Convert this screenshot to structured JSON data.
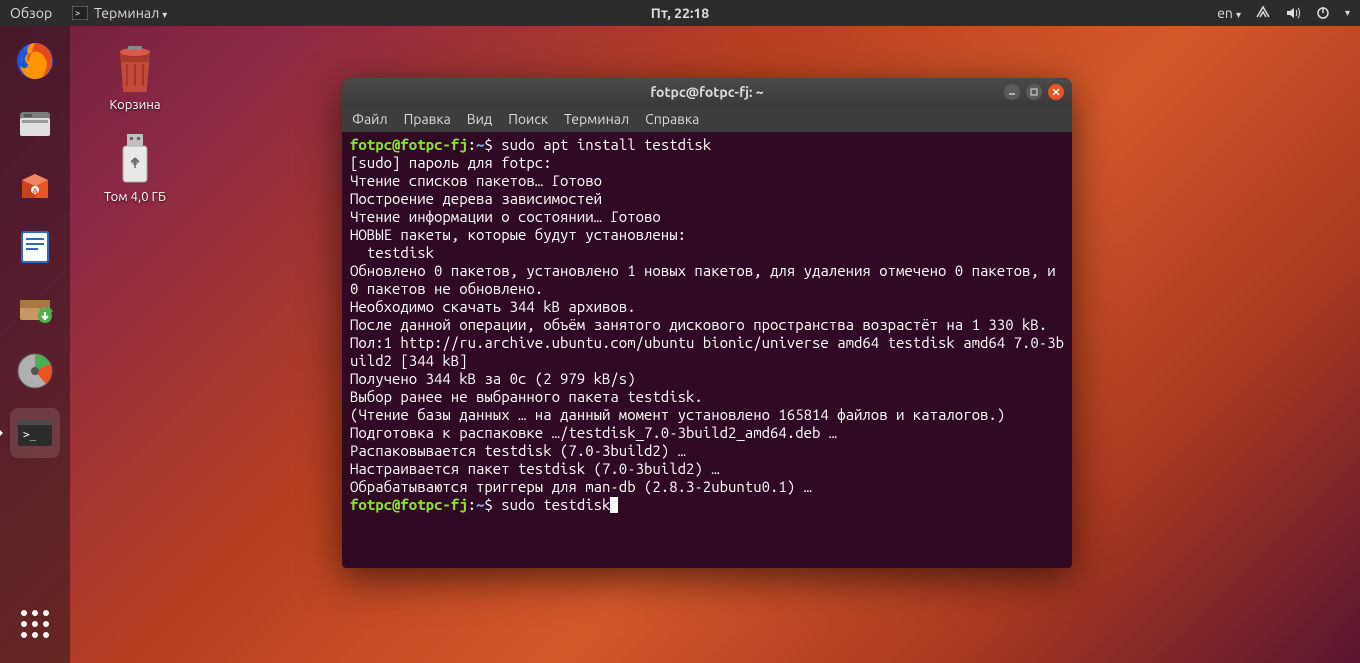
{
  "topbar": {
    "activities": "Обзор",
    "app_name": "Терминал",
    "clock": "Пт, 22:18",
    "lang": "en"
  },
  "desktop": {
    "trash": "Корзина",
    "usb": "Том 4,0 ГБ"
  },
  "window": {
    "title": "fotpc@fotpc-fj: ~",
    "menu": {
      "file": "Файл",
      "edit": "Правка",
      "view": "Вид",
      "search": "Поиск",
      "terminal": "Терминал",
      "help": "Справка"
    }
  },
  "terminal": {
    "prompt_user": "fotpc@fotpc-fj",
    "prompt_path": "~",
    "cmd1": "sudo apt install testdisk",
    "lines": [
      "[sudo] пароль для fotpc:",
      "Чтение списков пакетов… Готово",
      "Построение дерева зависимостей",
      "Чтение информации о состоянии… Готово",
      "НОВЫЕ пакеты, которые будут установлены:",
      "  testdisk",
      "Обновлено 0 пакетов, установлено 1 новых пакетов, для удаления отмечено 0 пакетов, и 0 пакетов не обновлено.",
      "Необходимо скачать 344 kB архивов.",
      "После данной операции, объём занятого дискового пространства возрастёт на 1 330 kB.",
      "Пол:1 http://ru.archive.ubuntu.com/ubuntu bionic/universe amd64 testdisk amd64 7.0-3build2 [344 kB]",
      "Получено 344 kB за 0с (2 979 kB/s)",
      "Выбор ранее не выбранного пакета testdisk.",
      "(Чтение базы данных … на данный момент установлено 165814 файлов и каталогов.)",
      "Подготовка к распаковке …/testdisk_7.0-3build2_amd64.deb …",
      "Распаковывается testdisk (7.0-3build2) …",
      "Настраивается пакет testdisk (7.0-3build2) …",
      "Обрабатываются триггеры для man-db (2.8.3-2ubuntu0.1) …"
    ],
    "cmd2": "sudo testdisk"
  }
}
